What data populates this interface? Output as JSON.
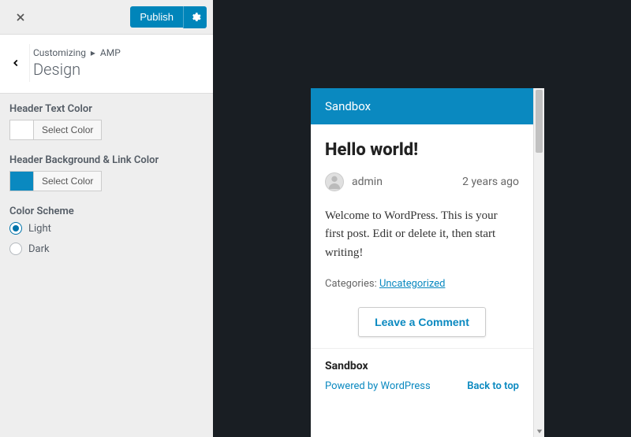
{
  "header": {
    "publish_label": "Publish"
  },
  "section": {
    "breadcrumb_root": "Customizing",
    "breadcrumb_leaf": "AMP",
    "title": "Design"
  },
  "controls": {
    "header_text_color": {
      "label": "Header Text Color",
      "button_label": "Select Color",
      "value": "#ffffff"
    },
    "header_bg_link_color": {
      "label": "Header Background & Link Color",
      "button_label": "Select Color",
      "value": "#0a89c0"
    },
    "color_scheme": {
      "label": "Color Scheme",
      "options": [
        {
          "label": "Light",
          "value": "light",
          "checked": true
        },
        {
          "label": "Dark",
          "value": "dark",
          "checked": false
        }
      ]
    }
  },
  "preview": {
    "site_title": "Sandbox",
    "post_title": "Hello world!",
    "author": "admin",
    "time": "2 years ago",
    "content": "Welcome to WordPress. This is your first post. Edit or delete it, then start writing!",
    "categories_label": "Categories:",
    "category_link": "Uncategorized",
    "comment_button": "Leave a Comment",
    "footer_title": "Sandbox",
    "powered_by": "Powered by WordPress",
    "back_to_top": "Back to top"
  }
}
